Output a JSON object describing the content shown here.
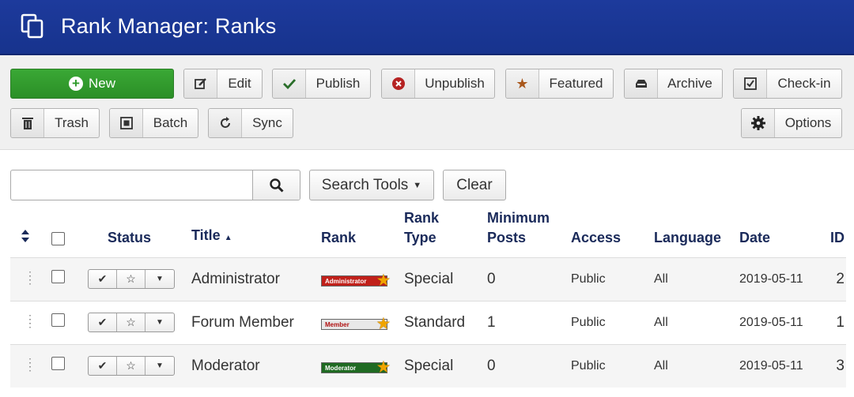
{
  "header": {
    "title": "Rank Manager: Ranks",
    "icon": "copy-icon"
  },
  "toolbar": {
    "new": "New",
    "edit": "Edit",
    "publish": "Publish",
    "unpublish": "Unpublish",
    "featured": "Featured",
    "archive": "Archive",
    "checkin": "Check-in",
    "trash": "Trash",
    "batch": "Batch",
    "sync": "Sync",
    "options": "Options"
  },
  "filters": {
    "search_value": "",
    "search_tools": "Search Tools",
    "clear": "Clear"
  },
  "table": {
    "headers": {
      "status": "Status",
      "title": "Title",
      "rank": "Rank",
      "rank_type_1": "Rank",
      "rank_type_2": "Type",
      "min_posts_1": "Minimum",
      "min_posts_2": "Posts",
      "access": "Access",
      "language": "Language",
      "date": "Date",
      "id": "ID"
    },
    "rows": [
      {
        "title": "Administrator",
        "rank_label": "Administrator",
        "rank_color": "#c0201a",
        "rank_text_color": "#ffffff",
        "type": "Special",
        "min_posts": "0",
        "access": "Public",
        "language": "All",
        "date": "2019-05-11",
        "id": "2"
      },
      {
        "title": "Forum Member",
        "rank_label": "Member",
        "rank_color": "#e8e8e8",
        "rank_text_color": "#b01010",
        "type": "Standard",
        "min_posts": "1",
        "access": "Public",
        "language": "All",
        "date": "2019-05-11",
        "id": "1"
      },
      {
        "title": "Moderator",
        "rank_label": "Moderator",
        "rank_color": "#1f6a22",
        "rank_text_color": "#ffffff",
        "type": "Special",
        "min_posts": "0",
        "access": "Public",
        "language": "All",
        "date": "2019-05-11",
        "id": "3"
      }
    ]
  }
}
